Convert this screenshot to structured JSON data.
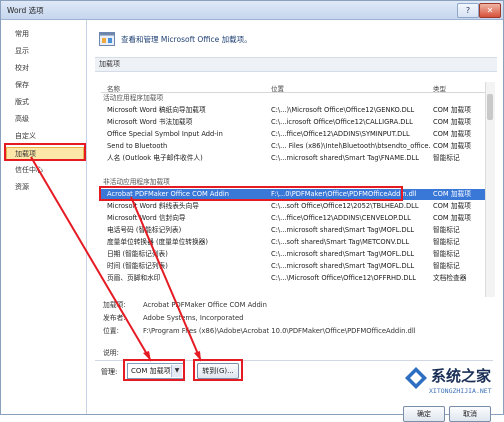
{
  "window": {
    "title": "Word 选项",
    "help_glyph": "?",
    "close_glyph": "✕"
  },
  "sidebar": {
    "items": [
      {
        "label": "常用"
      },
      {
        "label": "显示"
      },
      {
        "label": "校对"
      },
      {
        "label": "保存"
      },
      {
        "label": "版式"
      },
      {
        "label": "高级"
      },
      {
        "label": "自定义"
      },
      {
        "label": "加载项",
        "selected": true
      },
      {
        "label": "信任中心"
      },
      {
        "label": "资源"
      }
    ]
  },
  "header": {
    "text": "查看和管理 Microsoft Office 加载项。",
    "icon": "addins-icon"
  },
  "section": {
    "title": "加载项"
  },
  "columns": {
    "name": "名称",
    "location": "位置",
    "type": "类型"
  },
  "rows": [
    {
      "kind": "group",
      "name": "活动应用程序加载项",
      "location": "",
      "type": ""
    },
    {
      "kind": "item",
      "name": "Microsoft Word 稿纸向导加载项",
      "location": "C:\\...)\\Microsoft Office\\Office12\\GENKO.DLL",
      "type": "COM 加载项"
    },
    {
      "kind": "item",
      "name": "Microsoft Word 书法加载项",
      "location": "C:\\...icrosoft Office\\Office12\\CALLIGRA.DLL",
      "type": "COM 加载项"
    },
    {
      "kind": "item",
      "name": "Office Special Symbol Input Add-in",
      "location": "C:\\...ffice\\Office12\\ADDINS\\SYMINPUT.DLL",
      "type": "COM 加载项"
    },
    {
      "kind": "item",
      "name": "Send to Bluetooth",
      "location": "C:\\... Files (x86)\\Intel\\Bluetooth\\btsendto_office.dll",
      "type": "COM 加载项"
    },
    {
      "kind": "item",
      "name": "人名 (Outlook 电子邮件收件人)",
      "location": "C:\\...microsoft shared\\Smart Tag\\FNAME.DLL",
      "type": "智能标记"
    },
    {
      "kind": "spacer",
      "name": "",
      "location": "",
      "type": ""
    },
    {
      "kind": "group",
      "name": "非活动应用程序加载项",
      "location": "",
      "type": ""
    },
    {
      "kind": "item",
      "selected": true,
      "name": "Acrobat PDFMaker Office COM Addin",
      "location": "F:\\...0\\PDFMaker\\Office\\PDFMOfficeAddin.dll",
      "type": "COM 加载项"
    },
    {
      "kind": "item",
      "name": "Microsoft Word 斜线表头向导",
      "location": "C:\\...soft Office\\Office12\\2052\\TBLHEAD.DLL",
      "type": "COM 加载项"
    },
    {
      "kind": "item",
      "name": "Microsoft Word 信封向导",
      "location": "C:\\...ffice\\Office12\\ADDINS\\CENVELOP.DLL",
      "type": "COM 加载项"
    },
    {
      "kind": "item",
      "name": "电话号码 (智能标记列表)",
      "location": "C:\\...microsoft shared\\Smart Tag\\MOFL.DLL",
      "type": "智能标记"
    },
    {
      "kind": "item",
      "name": "度量单位转换器 (度量单位转换器)",
      "location": "C:\\...soft shared\\Smart Tag\\METCONV.DLL",
      "type": "智能标记"
    },
    {
      "kind": "item",
      "name": "日期 (智能标记列表)",
      "location": "C:\\...microsoft shared\\Smart Tag\\MOFL.DLL",
      "type": "智能标记"
    },
    {
      "kind": "item",
      "name": "时间 (智能标记列表)",
      "location": "C:\\...microsoft shared\\Smart Tag\\MOFL.DLL",
      "type": "智能标记"
    },
    {
      "kind": "item",
      "name": "页眉、页脚和水印",
      "location": "C:\\...\\Microsoft Office\\Office12\\OFFRHD.DLL",
      "type": "文档检查器"
    }
  ],
  "details": {
    "addin_label": "加载项:",
    "addin_value": "Acrobat PDFMaker Office COM Addin",
    "publisher_label": "发布者:",
    "publisher_value": "Adobe Systems, Incorporated",
    "location_label": "位置:",
    "location_value": "F:\\Program Files (x86)\\Adobe\\Acrobat 10.0\\PDFMaker\\Office\\PDFMOfficeAddin.dll",
    "description_label": "说明:"
  },
  "manage": {
    "label": "管理:",
    "selected": "COM 加载项",
    "go_button": "转到(G)..."
  },
  "footer": {
    "ok": "确定",
    "cancel": "取消"
  },
  "watermark": {
    "text": "系统之家",
    "url": "XITONGZHIJIA.NET"
  },
  "colors": {
    "highlight_box": "#e51b24",
    "selection": "#3a78d8",
    "nav_selected": "#fde7a8"
  }
}
